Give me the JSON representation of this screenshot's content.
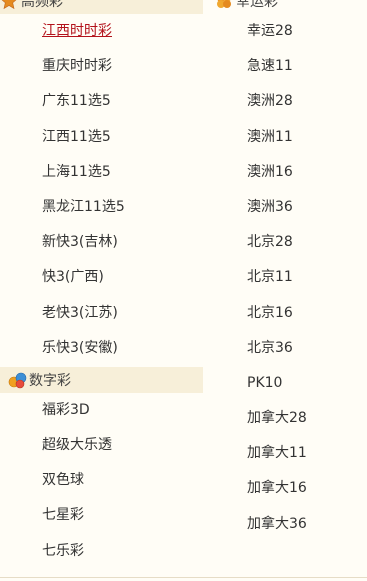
{
  "high_freq": {
    "title": "高频彩",
    "icon": "star-icon",
    "items": [
      "江西时时彩",
      "重庆时时彩",
      "广东11选5",
      "江西11选5",
      "上海11选5",
      "黑龙江11选5",
      "新快3(吉林)",
      "快3(广西)",
      "老快3(江苏)",
      "乐快3(安徽)"
    ],
    "active_index": 0
  },
  "digital": {
    "title": "数字彩",
    "icon": "lottery-balls-icon",
    "items": [
      "福彩3D",
      "超级大乐透",
      "双色球",
      "七星彩",
      "七乐彩"
    ]
  },
  "lucky": {
    "title": "幸运彩",
    "icon": "clover-icon",
    "items": [
      "幸运28",
      "急速11",
      "澳洲28",
      "澳洲11",
      "澳洲16",
      "澳洲36",
      "北京28",
      "北京11",
      "北京16",
      "北京36",
      "PK10",
      "加拿大28",
      "加拿大11",
      "加拿大16",
      "加拿大36"
    ]
  },
  "colors": {
    "active_link": "#b3121b",
    "header_bg": "#f7efd9",
    "page_bg": "#fffdf6"
  }
}
